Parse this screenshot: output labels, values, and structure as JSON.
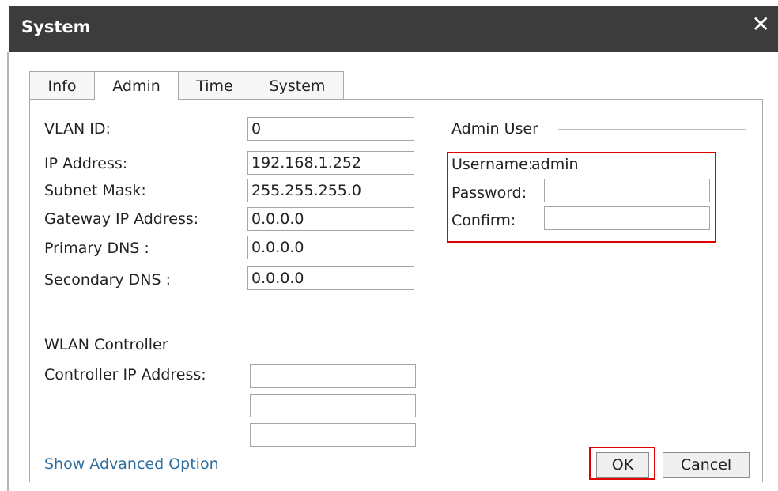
{
  "dialog": {
    "title": "System",
    "close_glyph": "✕"
  },
  "tabs": [
    {
      "label": "Info",
      "active": false
    },
    {
      "label": "Admin",
      "active": true
    },
    {
      "label": "Time",
      "active": false
    },
    {
      "label": "System",
      "active": false
    }
  ],
  "network": {
    "vlan_id": {
      "label": "VLAN ID:",
      "value": "0"
    },
    "ip_address": {
      "label": "IP Address:",
      "value": "192.168.1.252"
    },
    "subnet_mask": {
      "label": "Subnet Mask:",
      "value": "255.255.255.0"
    },
    "gateway": {
      "label": "Gateway IP Address:",
      "value": "0.0.0.0"
    },
    "primary_dns": {
      "label": "Primary DNS :",
      "value": "0.0.0.0"
    },
    "secondary_dns": {
      "label": "Secondary DNS :",
      "value": "0.0.0.0"
    }
  },
  "wlan_controller": {
    "heading": "WLAN Controller",
    "controller_label": "Controller IP Address:",
    "values": [
      "",
      "",
      ""
    ]
  },
  "admin_user": {
    "heading": "Admin User",
    "username_label": "Username:",
    "username_value": "admin",
    "password_label": "Password:",
    "password_value": "",
    "confirm_label": "Confirm:",
    "confirm_value": ""
  },
  "footer": {
    "advanced_link": "Show Advanced Option",
    "ok_label": "OK",
    "cancel_label": "Cancel"
  },
  "colors": {
    "title_bar": "#3c3c3c",
    "highlight": "#e00000",
    "link": "#2d6e9e"
  }
}
